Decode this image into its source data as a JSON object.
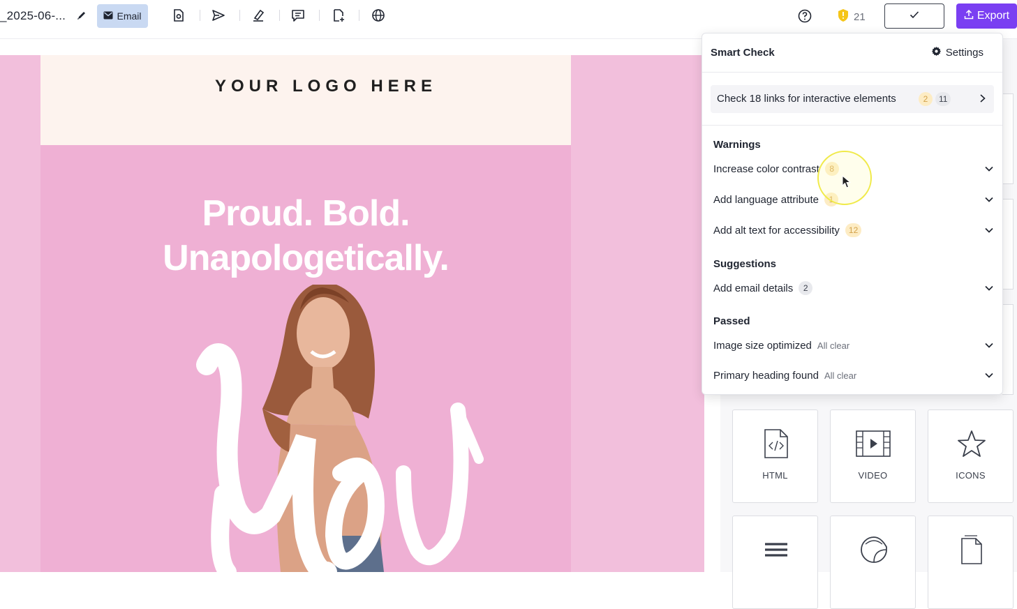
{
  "toolbar": {
    "doc_title": "_2025-06-...",
    "email_label": "Email",
    "credits": "21",
    "export_label": "Export"
  },
  "email": {
    "logo_text": "YOUR LOGO HERE",
    "headline_line1": "Proud. Bold.",
    "headline_line2": "Unapologetically.",
    "script_word": "You"
  },
  "smart_check": {
    "title": "Smart Check",
    "settings_label": "Settings",
    "links": {
      "text": "Check 18 links for interactive elements",
      "warn_count": "2",
      "total_count": "11"
    },
    "warnings_title": "Warnings",
    "warnings": [
      {
        "label": "Increase color contrast",
        "count": "8"
      },
      {
        "label": "Add language attribute",
        "count": "1"
      },
      {
        "label": "Add alt text for accessibility",
        "count": "12"
      }
    ],
    "suggestions_title": "Suggestions",
    "suggestions": [
      {
        "label": "Add email details",
        "count": "2"
      }
    ],
    "passed_title": "Passed",
    "passed": [
      {
        "label": "Image size optimized",
        "note": "All clear"
      },
      {
        "label": "Primary heading found",
        "note": "All clear"
      }
    ]
  },
  "blocks": [
    {
      "label": "HTML",
      "icon": "html-icon"
    },
    {
      "label": "VIDEO",
      "icon": "video-icon"
    },
    {
      "label": "ICONS",
      "icon": "star-icon"
    }
  ],
  "colors": {
    "accent": "#7a3ff2",
    "canvas_bg": "#f2bfdc",
    "hero_bg": "#efb0d4",
    "logo_band": "#fdf3ee",
    "email_chip": "#c9d9f2",
    "warn_badge": "#fdecc4"
  }
}
